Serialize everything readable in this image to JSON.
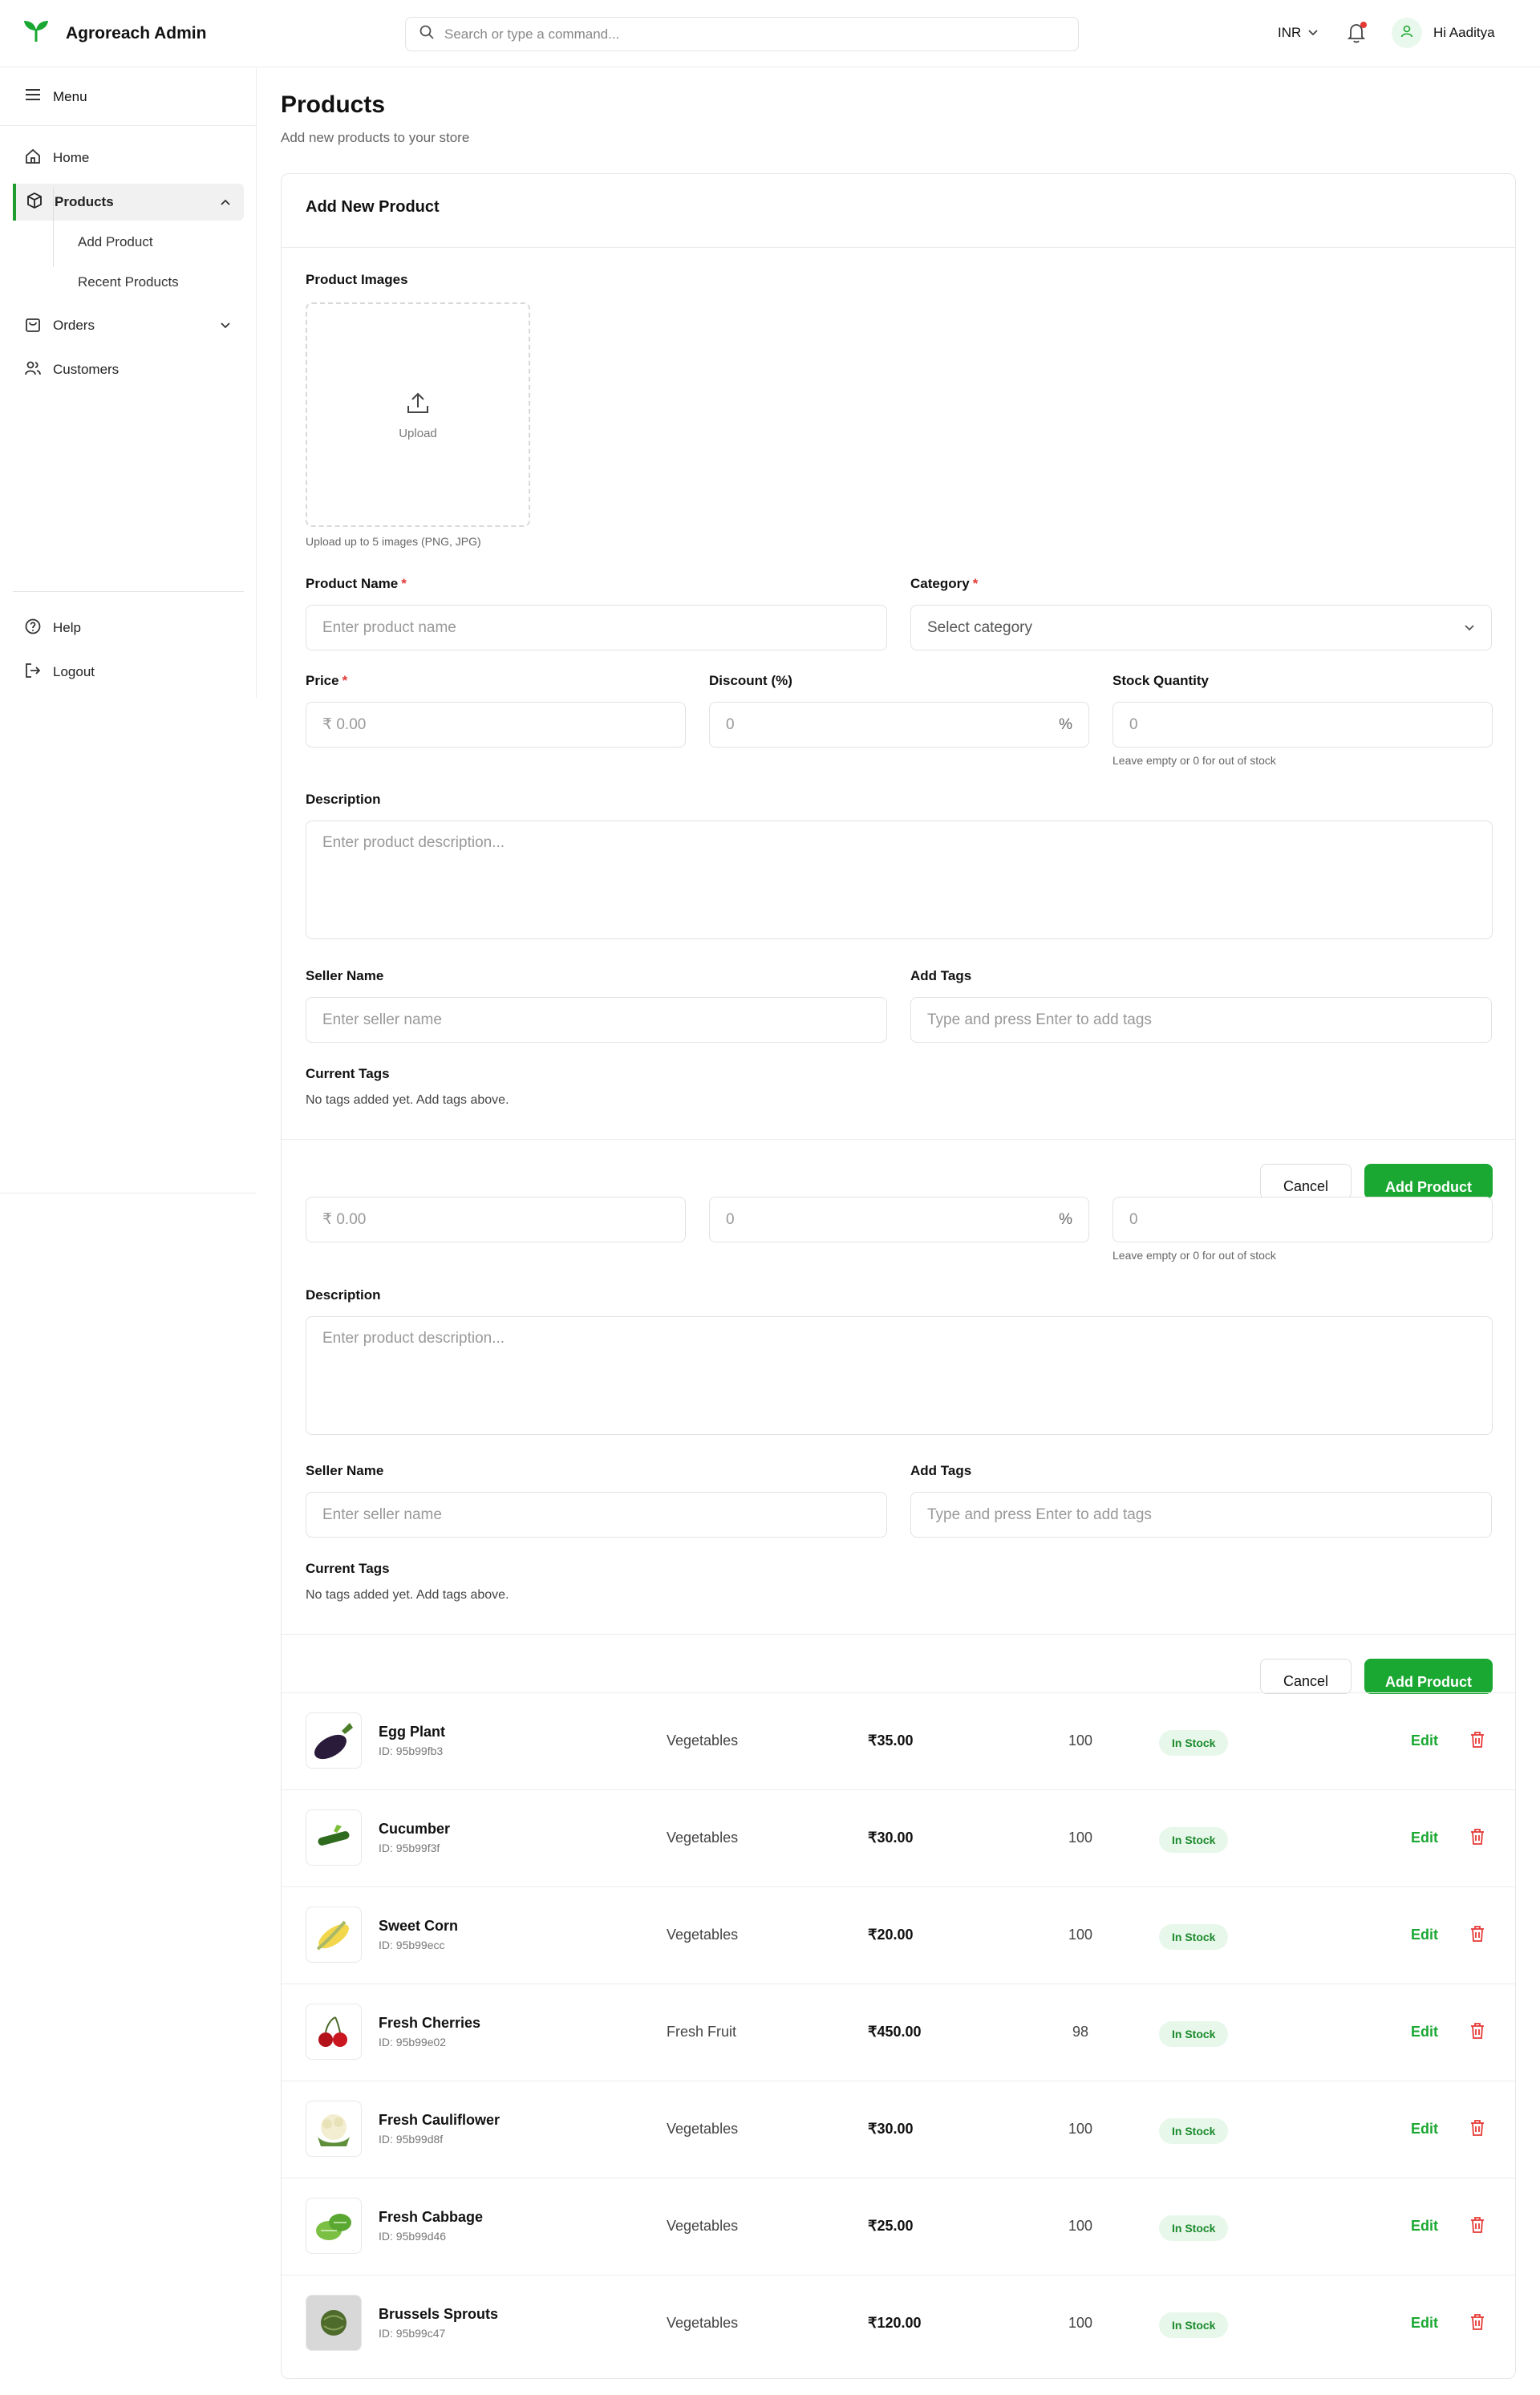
{
  "app": {
    "title": "Agroreach Admin"
  },
  "search": {
    "placeholder": "Search or type a command..."
  },
  "header": {
    "currency": "INR",
    "greeting": "Hi Aaditya"
  },
  "sidebar": {
    "menu_label": "Menu",
    "items": [
      {
        "label": "Home",
        "icon": "home-icon"
      },
      {
        "label": "Products",
        "icon": "box-icon",
        "active": true,
        "children": [
          "Add Product",
          "Recent Products"
        ]
      },
      {
        "label": "Orders",
        "icon": "bag-icon"
      },
      {
        "label": "Customers",
        "icon": "users-icon"
      }
    ],
    "bottom": [
      {
        "label": "Help",
        "icon": "help-icon"
      },
      {
        "label": "Logout",
        "icon": "logout-icon"
      }
    ]
  },
  "page": {
    "title": "Products",
    "subtitle": "Add new products to your store"
  },
  "form": {
    "title": "Add New Product",
    "images_label": "Product Images",
    "upload_label": "Upload",
    "upload_hint": "Upload up to 5 images (PNG, JPG)",
    "product_name_label": "Product Name",
    "product_name_placeholder": "Enter product name",
    "category_label": "Category",
    "category_placeholder": "Select category",
    "price_label": "Price",
    "price_placeholder": "₹ 0.00",
    "discount_label": "Discount (%)",
    "discount_placeholder": "0",
    "discount_suffix": "%",
    "stock_label": "Stock Quantity",
    "stock_placeholder": "0",
    "stock_hint": "Leave empty or 0 for out of stock",
    "description_label": "Description",
    "description_placeholder": "Enter product description...",
    "seller_label": "Seller Name",
    "seller_placeholder": "Enter seller name",
    "tags_label": "Add Tags",
    "tags_placeholder": "Type and press Enter to add tags",
    "current_tags_label": "Current Tags",
    "no_tags_text": "No tags added yet. Add tags above.",
    "required_mark": "*",
    "cancel_label": "Cancel",
    "add_label": "Add Product"
  },
  "products": {
    "edit_label": "Edit",
    "rows": [
      {
        "name": "Egg Plant",
        "id": "ID: 95b99fb3",
        "category": "Vegetables",
        "price": "₹35.00",
        "qty": "100",
        "status": "In Stock",
        "image": "eggplant"
      },
      {
        "name": "Cucumber",
        "id": "ID: 95b99f3f",
        "category": "Vegetables",
        "price": "₹30.00",
        "qty": "100",
        "status": "In Stock",
        "image": "cucumber"
      },
      {
        "name": "Sweet Corn",
        "id": "ID: 95b99ecc",
        "category": "Vegetables",
        "price": "₹20.00",
        "qty": "100",
        "status": "In Stock",
        "image": "corn"
      },
      {
        "name": "Fresh Cherries",
        "id": "ID: 95b99e02",
        "category": "Fresh Fruit",
        "price": "₹450.00",
        "qty": "98",
        "status": "In Stock",
        "image": "cherries"
      },
      {
        "name": "Fresh Cauliflower",
        "id": "ID: 95b99d8f",
        "category": "Vegetables",
        "price": "₹30.00",
        "qty": "100",
        "status": "In Stock",
        "image": "cauliflower"
      },
      {
        "name": "Fresh Cabbage",
        "id": "ID: 95b99d46",
        "category": "Vegetables",
        "price": "₹25.00",
        "qty": "100",
        "status": "In Stock",
        "image": "cabbage"
      },
      {
        "name": "Brussels Sprouts",
        "id": "ID: 95b99c47",
        "category": "Vegetables",
        "price": "₹120.00",
        "qty": "100",
        "status": "In Stock",
        "image": "sprouts"
      }
    ]
  },
  "colors": {
    "accent": "#1aa832",
    "required": "#e53935",
    "status_bg": "#e7f7ea"
  }
}
